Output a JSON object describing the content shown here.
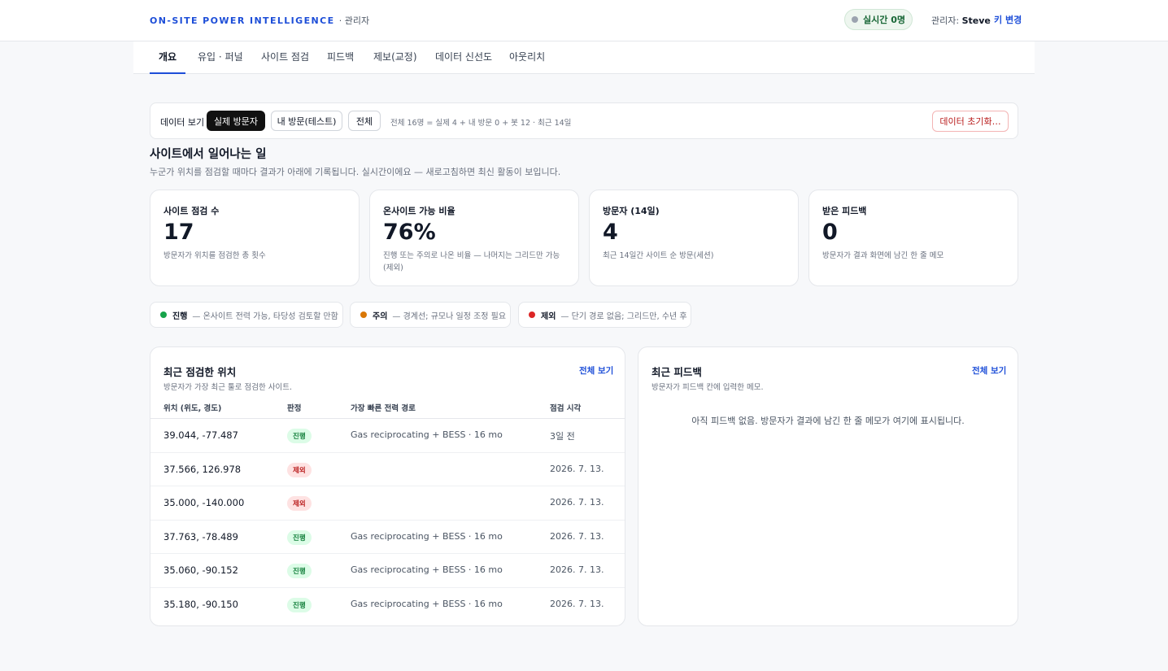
{
  "header": {
    "brand": "ON-SITE POWER INTELLIGENCE",
    "brand_sub": "· 관리자",
    "live": "실시간 0명",
    "admin_prefix": "관리자:",
    "admin_name": "Steve",
    "key_change": "키 변경",
    "colors": {
      "accent": "#1d4ed8",
      "live_dot": "#9ca3af"
    }
  },
  "tabs": [
    {
      "label": "개요",
      "active": true
    },
    {
      "label": "유입 · 퍼널"
    },
    {
      "label": "사이트 점검"
    },
    {
      "label": "피드백"
    },
    {
      "label": "제보(교정)"
    },
    {
      "label": "데이터 신선도"
    },
    {
      "label": "아웃리치"
    }
  ],
  "filter": {
    "label": "데이터 보기",
    "options": [
      {
        "label": "실제 방문자",
        "selected": true
      },
      {
        "label": "내 방문(테스트)"
      },
      {
        "label": "전체"
      }
    ],
    "summary": "전체 16명 = 실제 4 + 내 방문 0 + 봇 12 · 최근 14일",
    "reset": "데이터 초기화…"
  },
  "section": {
    "title": "사이트에서 일어나는 일",
    "desc": "누군가 위치를 점검할 때마다 결과가 아래에 기록됩니다. 실시간이에요 — 새로고침하면 최신 활동이 보입니다."
  },
  "kpis": [
    {
      "label": "사이트 점검 수",
      "value": "17",
      "desc": "방문자가 위치를 점검한 총 횟수"
    },
    {
      "label": "온사이트 가능 비율",
      "value": "76%",
      "desc": "진행 또는 주의로 나온 비율 — 나머지는 그리드만 가능(제외)"
    },
    {
      "label": "방문자 (14일)",
      "value": "4",
      "desc": "최근 14일간 사이트 순 방문(세션)"
    },
    {
      "label": "받은 피드백",
      "value": "0",
      "desc": "방문자가 결과 화면에 남긴 한 줄 메모"
    }
  ],
  "legend": [
    {
      "name": "진행",
      "desc": "— 온사이트 전력 가능, 타당성 검토할 만함",
      "color": "#16a34a"
    },
    {
      "name": "주의",
      "desc": "— 경계선; 규모나 일정 조정 필요",
      "color": "#d97706"
    },
    {
      "name": "제외",
      "desc": "— 단기 경로 없음; 그리드만, 수년 후",
      "color": "#dc2626"
    }
  ],
  "recent_sites": {
    "title": "최근 점검한 위치",
    "sub": "방문자가 가장 최근 툴로 점검한 사이트.",
    "link": "전체 보기",
    "columns": [
      "위치 (위도, 경도)",
      "판정",
      "가장 빠른 전력 경로",
      "점검 시각"
    ],
    "rows": [
      {
        "loc": "39.044, -77.487",
        "verdict": "진행",
        "kind": "go",
        "route": "Gas reciprocating + BESS · 16 mo",
        "time": "3일 전"
      },
      {
        "loc": "37.566, 126.978",
        "verdict": "제외",
        "kind": "excl",
        "route": "",
        "time": "2026. 7. 13."
      },
      {
        "loc": "35.000, -140.000",
        "verdict": "제외",
        "kind": "excl",
        "route": "",
        "time": "2026. 7. 13."
      },
      {
        "loc": "37.763, -78.489",
        "verdict": "진행",
        "kind": "go",
        "route": "Gas reciprocating + BESS · 16 mo",
        "time": "2026. 7. 13."
      },
      {
        "loc": "35.060, -90.152",
        "verdict": "진행",
        "kind": "go",
        "route": "Gas reciprocating + BESS · 16 mo",
        "time": "2026. 7. 13."
      },
      {
        "loc": "35.180, -90.150",
        "verdict": "진행",
        "kind": "go",
        "route": "Gas reciprocating + BESS · 16 mo",
        "time": "2026. 7. 13."
      }
    ]
  },
  "recent_feedback": {
    "title": "최근 피드백",
    "sub": "방문자가 피드백 칸에 입력한 메모.",
    "link": "전체 보기",
    "empty": "아직 피드백 없음. 방문자가 결과에 남긴 한 줄 메모가 여기에 표시됩니다."
  }
}
